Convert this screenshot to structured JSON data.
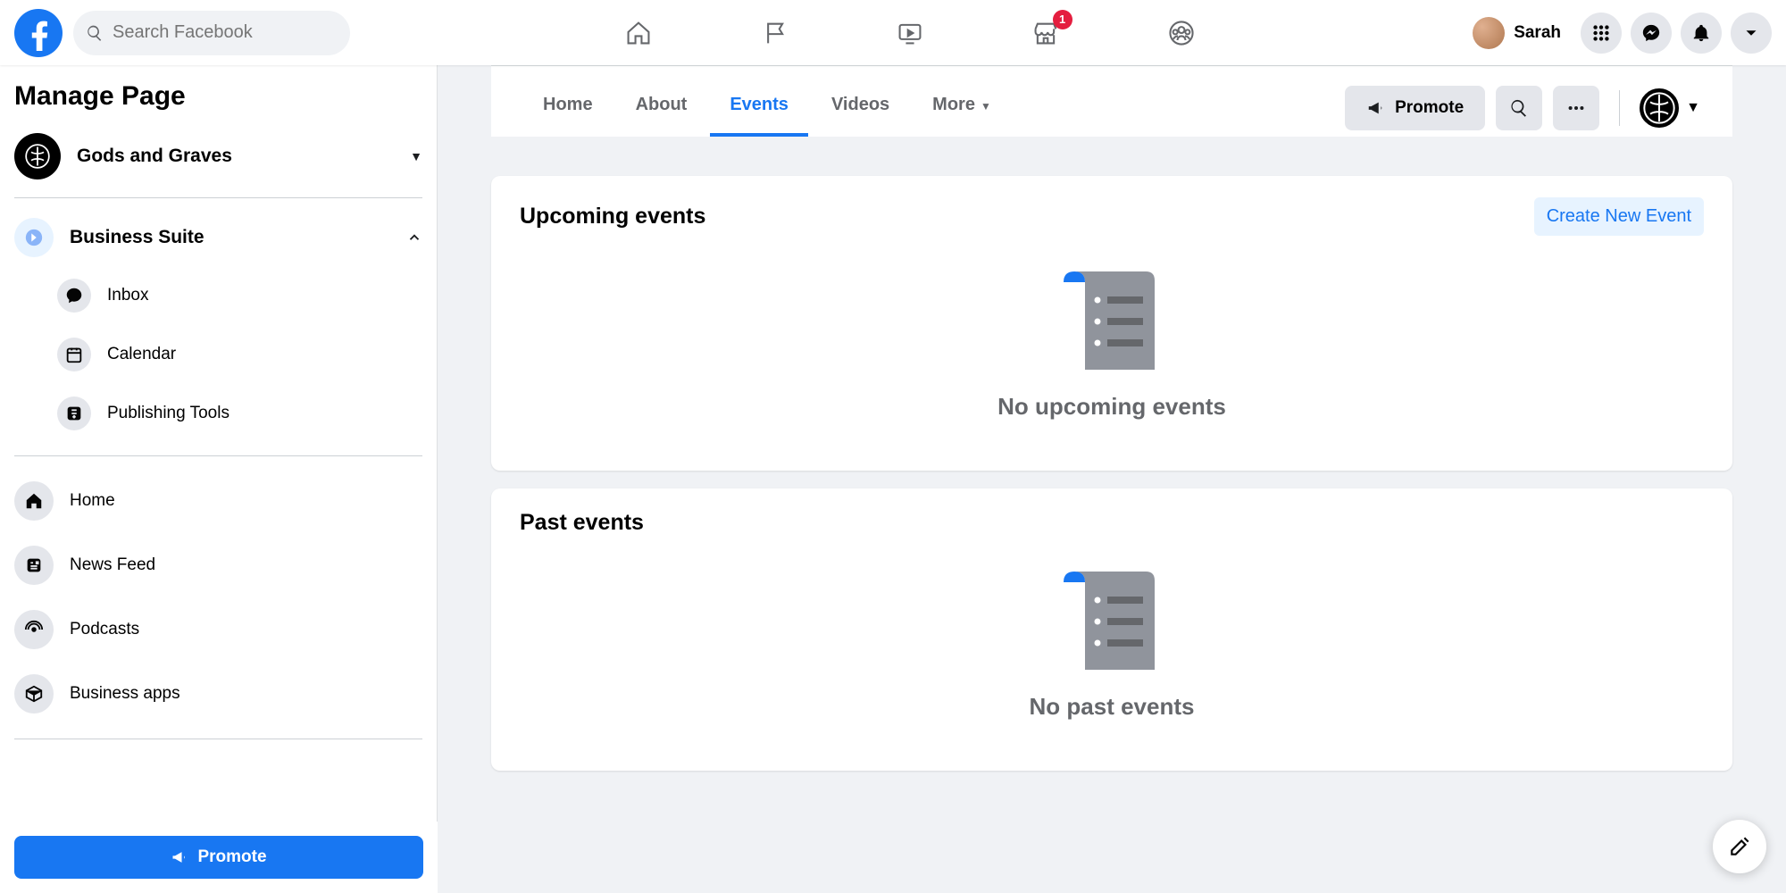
{
  "header": {
    "search_placeholder": "Search Facebook",
    "marketplace_badge": "1",
    "user_name": "Sarah"
  },
  "sidebar": {
    "title": "Manage Page",
    "page_name": "Gods and Graves",
    "business_suite_label": "Business Suite",
    "sub_items": [
      {
        "label": "Inbox"
      },
      {
        "label": "Calendar"
      },
      {
        "label": "Publishing Tools"
      }
    ],
    "items": [
      {
        "label": "Home"
      },
      {
        "label": "News Feed"
      },
      {
        "label": "Podcasts"
      },
      {
        "label": "Business apps"
      }
    ],
    "promote_label": "Promote"
  },
  "page_tabs": {
    "tabs": [
      {
        "label": "Home"
      },
      {
        "label": "About"
      },
      {
        "label": "Events"
      },
      {
        "label": "Videos"
      },
      {
        "label": "More"
      }
    ],
    "active_index": 2,
    "promote_label": "Promote"
  },
  "cards": {
    "upcoming": {
      "title": "Upcoming events",
      "create_label": "Create New Event",
      "empty_text": "No upcoming events"
    },
    "past": {
      "title": "Past events",
      "empty_text": "No past events"
    }
  }
}
